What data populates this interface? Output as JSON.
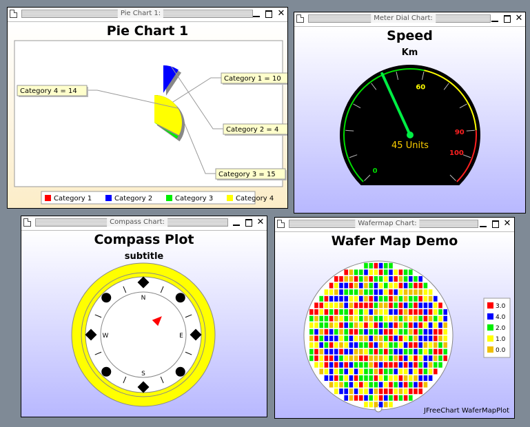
{
  "pie_window": {
    "window_title": "Pie Chart 1:"
  },
  "meter_window": {
    "window_title": "Meter Dial Chart:"
  },
  "compass_window": {
    "window_title": "Compass Chart:"
  },
  "wafer_window": {
    "window_title": "Wafermap Chart:"
  },
  "chart_data": [
    {
      "type": "pie",
      "title": "Pie Chart 1",
      "categories": [
        "Category 1",
        "Category 2",
        "Category 3",
        "Category 4"
      ],
      "values": [
        10,
        4,
        15,
        14
      ],
      "slice_labels": [
        "Category 1 = 10",
        "Category 2 = 4",
        "Category 3 = 15",
        "Category 4 = 14"
      ],
      "colors": [
        "#ff0000",
        "#0000ff",
        "#00ee00",
        "#ffff00"
      ],
      "exploded": [
        "Category 2"
      ],
      "legend": "bottom"
    },
    {
      "type": "meter",
      "title": "Speed",
      "subtitle": "Km",
      "value": 45,
      "value_label": "45 Units",
      "tick_labels": [
        "0",
        "60",
        "90",
        "100"
      ],
      "range": [
        0,
        110
      ]
    },
    {
      "type": "compass",
      "title": "Compass Plot",
      "subtitle": "subtitle",
      "direction_labels": [
        "N",
        "E",
        "S",
        "W"
      ],
      "needle_bearing_deg": 45
    },
    {
      "type": "heatmap",
      "title": "Wafer Map Demo",
      "legend_values": [
        "3.0",
        "4.0",
        "2.0",
        "1.0",
        "0.0"
      ],
      "legend_colors": [
        "#ff0000",
        "#0000ff",
        "#00ee00",
        "#ffff00",
        "#f0c000"
      ],
      "footer": "JFreeChart WaferMapPlot"
    }
  ]
}
